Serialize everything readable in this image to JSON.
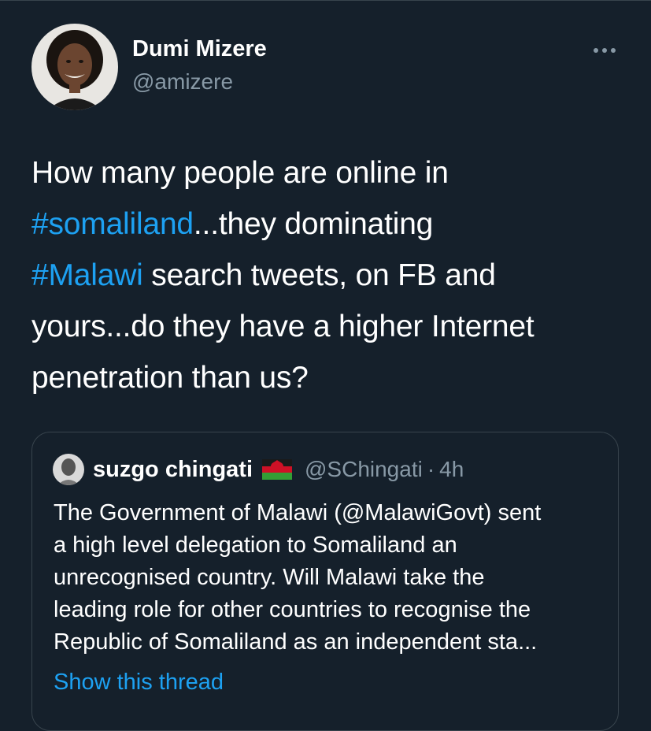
{
  "tweet": {
    "author": {
      "display_name": "Dumi Mizere",
      "handle": "@amizere"
    },
    "text": {
      "line1": "How many people are online in",
      "line2_hashtag": "#somaliland",
      "line2_rest": "...they dominating",
      "line3_hashtag": "#Malawi",
      "line3_rest": " search tweets, on FB and",
      "line4": "yours...do they have a higher Internet",
      "line5": "penetration than us?"
    },
    "more_icon": "more-horizontal-icon"
  },
  "quoted_tweet": {
    "author": {
      "display_name": "suzgo chingati",
      "flag_icon": "malawi-flag-icon",
      "handle": "@SChingati",
      "separator": "·",
      "time": "4h"
    },
    "text_lines": [
      "The Government of Malawi (@MalawiGovt) sent",
      "a high level delegation to Somaliland an",
      "unrecognised country. Will Malawi take the",
      "leading role for other countries to recognise the",
      "Republic of Somaliland as an independent sta..."
    ],
    "show_thread_label": "Show this thread"
  },
  "colors": {
    "background": "#15202b",
    "text_primary": "#ffffff",
    "text_secondary": "#8899a6",
    "accent": "#1da1f2",
    "border": "#38444d"
  }
}
